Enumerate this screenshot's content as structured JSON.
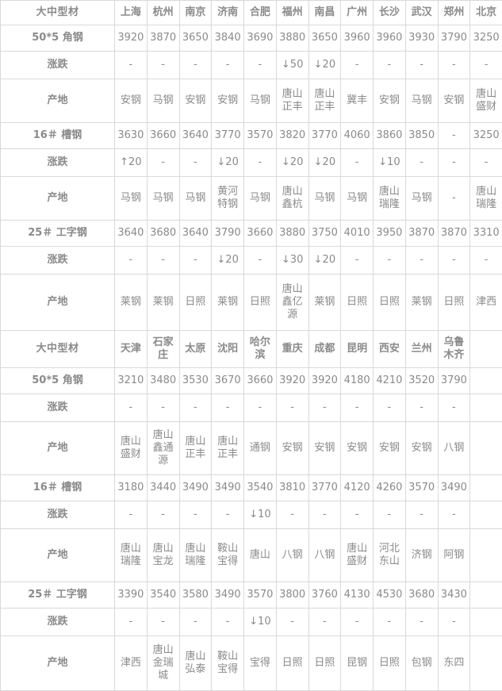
{
  "table": {
    "title": "大中型材",
    "labels": {
      "angle": "50*5 角钢",
      "channel": "16＃ 槽钢",
      "ibeam": "25＃ 工字钢",
      "change": "涨跌",
      "origin": "产地"
    },
    "section1": {
      "cities": [
        "上海",
        "杭州",
        "南京",
        "济南",
        "合肥",
        "福州",
        "南昌",
        "广州",
        "长沙",
        "武汉",
        "郑州",
        "北京"
      ],
      "angle": {
        "prices": [
          "3920",
          "3870",
          "3650",
          "3840",
          "3690",
          "3880",
          "3650",
          "3960",
          "3960",
          "3930",
          "3790",
          "3250"
        ],
        "changes": [
          "-",
          "-",
          "-",
          "-",
          "-",
          "↓50",
          "↓20",
          "-",
          "-",
          "-",
          "-",
          "-"
        ],
        "change_dirs": [
          "flat",
          "flat",
          "flat",
          "flat",
          "flat",
          "down",
          "down",
          "flat",
          "flat",
          "flat",
          "flat",
          "flat"
        ],
        "origins": [
          "安钢",
          "马钢",
          "安钢",
          "安钢",
          "马钢",
          "唐山\n正丰",
          "唐山\n正丰",
          "冀丰",
          "安钢",
          "马钢",
          "安钢",
          "唐山\n盛财"
        ]
      },
      "channel": {
        "prices": [
          "3630",
          "3660",
          "3640",
          "3770",
          "3570",
          "3820",
          "3770",
          "4060",
          "3860",
          "3850",
          "-",
          "3250"
        ],
        "changes": [
          "↑20",
          "-",
          "-",
          "↓20",
          "-",
          "↓20",
          "↓20",
          "-",
          "↓10",
          "-",
          "-",
          "-"
        ],
        "change_dirs": [
          "up",
          "flat",
          "flat",
          "down",
          "flat",
          "down",
          "down",
          "flat",
          "down",
          "flat",
          "flat",
          "flat"
        ],
        "origins": [
          "马钢",
          "马钢",
          "马钢",
          "黄河\n特钢",
          "马钢",
          "唐山\n鑫杭",
          "马钢",
          "马钢",
          "唐山\n瑞隆",
          "马钢",
          "-",
          "唐山\n瑞隆"
        ]
      },
      "ibeam": {
        "prices": [
          "3640",
          "3680",
          "3640",
          "3790",
          "3660",
          "3880",
          "3750",
          "4010",
          "3950",
          "3870",
          "3870",
          "3310"
        ],
        "changes": [
          "-",
          "-",
          "-",
          "↓20",
          "-",
          "↓30",
          "↓20",
          "-",
          "-",
          "-",
          "-",
          "-"
        ],
        "change_dirs": [
          "flat",
          "flat",
          "flat",
          "down",
          "flat",
          "down",
          "down",
          "flat",
          "flat",
          "flat",
          "flat",
          "flat"
        ],
        "origins": [
          "莱钢",
          "莱钢",
          "日照",
          "莱钢",
          "日照",
          "唐山\n鑫亿\n源",
          "莱钢",
          "日照",
          "日照",
          "莱钢",
          "日照",
          "津西"
        ]
      }
    },
    "section2": {
      "cities": [
        "天津",
        "石家\n庄",
        "太原",
        "沈阳",
        "哈尔\n滨",
        "重庆",
        "成都",
        "昆明",
        "西安",
        "兰州",
        "乌鲁\n木齐",
        ""
      ],
      "angle": {
        "prices": [
          "3210",
          "3480",
          "3530",
          "3670",
          "3660",
          "3920",
          "3920",
          "4180",
          "4210",
          "3520",
          "3790",
          ""
        ],
        "changes": [
          "-",
          "-",
          "-",
          "-",
          "-",
          "-",
          "-",
          "-",
          "-",
          "-",
          "-",
          ""
        ],
        "change_dirs": [
          "flat",
          "flat",
          "flat",
          "flat",
          "flat",
          "flat",
          "flat",
          "flat",
          "flat",
          "flat",
          "flat",
          "none"
        ],
        "origins": [
          "唐山\n盛财",
          "唐山\n鑫通\n源",
          "唐山\n正丰",
          "唐山\n正丰",
          "通钢",
          "安钢",
          "安钢",
          "安钢",
          "安钢",
          "安钢",
          "八钢",
          ""
        ]
      },
      "channel": {
        "prices": [
          "3180",
          "3440",
          "3490",
          "3490",
          "3540",
          "3810",
          "3770",
          "4120",
          "4260",
          "3570",
          "3490",
          ""
        ],
        "changes": [
          "-",
          "-",
          "-",
          "-",
          "↓10",
          "-",
          "-",
          "-",
          "-",
          "-",
          "-",
          ""
        ],
        "change_dirs": [
          "flat",
          "flat",
          "flat",
          "flat",
          "down",
          "flat",
          "flat",
          "flat",
          "flat",
          "flat",
          "flat",
          "none"
        ],
        "origins": [
          "唐山\n瑞隆",
          "唐山\n宝龙",
          "唐山\n瑞隆",
          "鞍山\n宝得",
          "唐山",
          "八钢",
          "八钢",
          "唐山\n盛财",
          "河北\n东山",
          "济钢",
          "阿钢",
          ""
        ]
      },
      "ibeam": {
        "prices": [
          "3390",
          "3540",
          "3580",
          "3490",
          "3570",
          "3800",
          "3760",
          "4130",
          "4530",
          "3680",
          "3430",
          ""
        ],
        "changes": [
          "-",
          "-",
          "-",
          "-",
          "↓10",
          "-",
          "-",
          "-",
          "-",
          "-",
          "-",
          ""
        ],
        "change_dirs": [
          "flat",
          "flat",
          "flat",
          "flat",
          "down",
          "flat",
          "flat",
          "flat",
          "flat",
          "flat",
          "flat",
          "none"
        ],
        "origins": [
          "津西",
          "唐山\n金瑞\n城",
          "唐山\n弘泰",
          "鞍山\n宝得",
          "宝得",
          "日照",
          "日照",
          "昆钢",
          "日照",
          "包钢",
          "东四",
          ""
        ]
      }
    }
  },
  "colors": {
    "title_red": "#ff0000",
    "city_blue": "#2323dd",
    "up_red": "#e8460f",
    "down_green": "#1b7a43",
    "value_gray": "#8f8f8f",
    "border_gray": "#d9d9d9"
  }
}
